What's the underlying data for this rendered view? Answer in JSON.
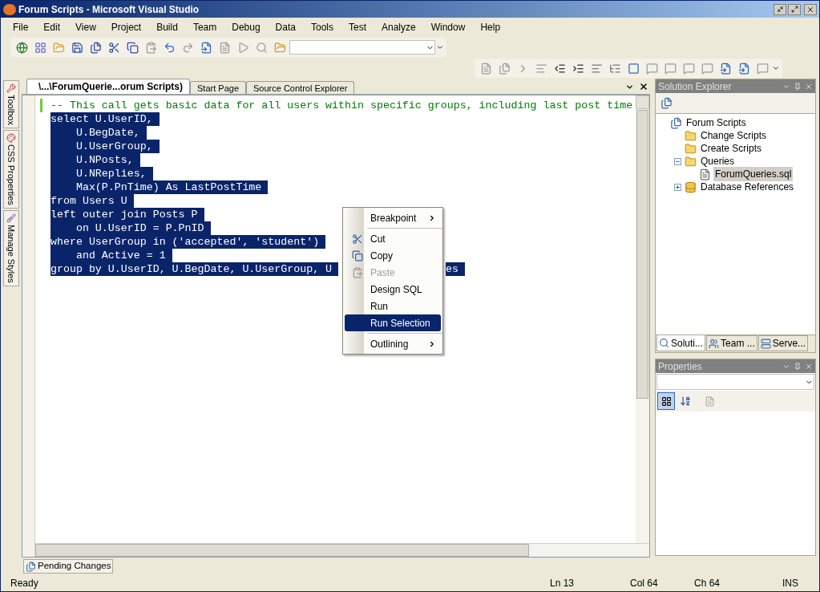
{
  "window": {
    "title": "Forum Scripts - Microsoft Visual Studio"
  },
  "menu_bar": [
    "File",
    "Edit",
    "View",
    "Project",
    "Build",
    "Team",
    "Debug",
    "Data",
    "Tools",
    "Test",
    "Analyze",
    "Window",
    "Help"
  ],
  "side_tabs": [
    "Toolbox",
    "CSS Properties",
    "Manage Styles"
  ],
  "document_tabs": [
    {
      "label": "\\...\\ForumQuerie...orum Scripts)",
      "selected": true
    },
    {
      "label": "Start Page",
      "selected": false
    },
    {
      "label": "Source Control Explorer",
      "selected": false
    }
  ],
  "editor": {
    "comment": "-- This call gets basic data for all users within specific groups, including last post time",
    "lines": [
      {
        "segments": [
          "select U.UserID,"
        ]
      },
      {
        "segments": [
          "    U.BegDate,"
        ]
      },
      {
        "segments": [
          "    U.UserGroup,"
        ]
      },
      {
        "segments": [
          "    U.NPosts,"
        ]
      },
      {
        "segments": [
          "    U.NReplies,"
        ]
      },
      {
        "segments": [
          "    Max(P.PnTime) As LastPostTime"
        ]
      },
      {
        "segments": [
          "from Users U"
        ]
      },
      {
        "segments": [
          "left outer join Posts P"
        ]
      },
      {
        "segments": [
          "    on U.UserID = P.PnID"
        ]
      },
      {
        "segments": [
          "where UserGroup in ('accepted', 'student')"
        ]
      },
      {
        "segments": [
          "    and Active = 1"
        ]
      },
      {
        "segments": [
          "group by U.UserID, U.BegDate, U.UserGroup, U",
          "es"
        ]
      }
    ]
  },
  "context_menu": [
    {
      "kind": "item",
      "label": "Breakpoint",
      "submenu": true,
      "disabled": false,
      "selected": false
    },
    {
      "kind": "separator"
    },
    {
      "kind": "icon_item",
      "label": "Cut",
      "submenu": false,
      "disabled": false,
      "selected": false
    },
    {
      "kind": "icon_item",
      "label": "Copy",
      "submenu": false,
      "disabled": false,
      "selected": false
    },
    {
      "kind": "icon_item",
      "label": "Paste",
      "submenu": false,
      "disabled": true,
      "selected": false
    },
    {
      "kind": "item",
      "label": "Design SQL",
      "submenu": false,
      "disabled": false,
      "selected": false
    },
    {
      "kind": "item",
      "label": "Run",
      "submenu": false,
      "disabled": false,
      "selected": false
    },
    {
      "kind": "item",
      "label": "Run Selection",
      "submenu": false,
      "disabled": false,
      "selected": true
    },
    {
      "kind": "separator"
    },
    {
      "kind": "item",
      "label": "Outlining",
      "submenu": true,
      "disabled": false,
      "selected": false
    }
  ],
  "solution_explorer": {
    "title": "Solution Explorer",
    "tree": [
      {
        "label": "Forum Scripts",
        "kind": "project",
        "selected": false,
        "children": [
          {
            "label": "Change Scripts",
            "kind": "folder",
            "selected": false
          },
          {
            "label": "Create Scripts",
            "kind": "folder",
            "selected": false
          },
          {
            "label": "Queries",
            "kind": "folder",
            "selected": false,
            "expanded": true,
            "children": [
              {
                "label": "ForumQueries.sql",
                "kind": "file",
                "selected": true
              }
            ]
          },
          {
            "label": "Database References",
            "kind": "database",
            "selected": false,
            "expanded": false
          }
        ]
      }
    ],
    "tabs": [
      {
        "label": "Soluti...",
        "selected": true
      },
      {
        "label": "Team ...",
        "selected": false
      },
      {
        "label": "Serve...",
        "selected": false
      }
    ]
  },
  "properties": {
    "title": "Properties"
  },
  "bottom_tabs": [
    "Pending Changes"
  ],
  "status_bar": {
    "message": "Ready",
    "line": "Ln 13",
    "column": "Col 64",
    "char": "Ch 64",
    "mode": "INS"
  }
}
